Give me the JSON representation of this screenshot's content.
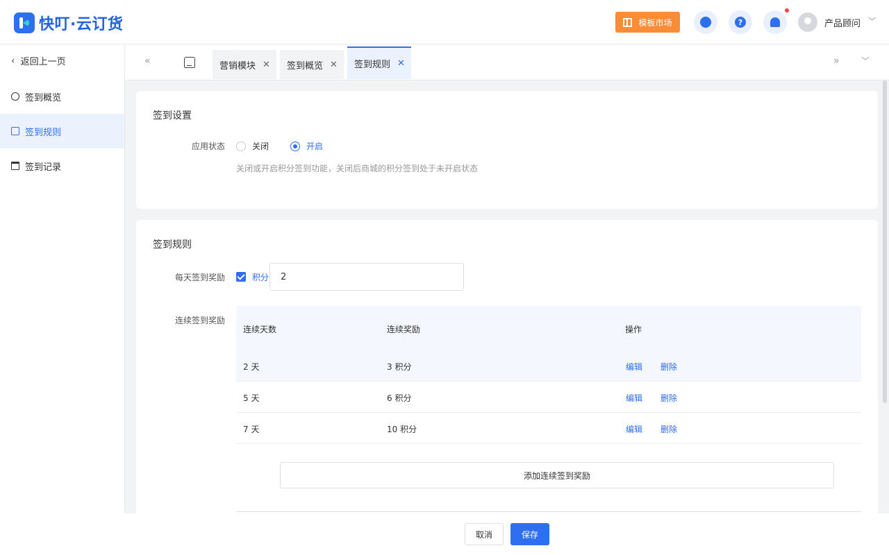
{
  "header": {
    "brand": "快叮·云订货",
    "market_label": "模板市场",
    "help_glyph": "?",
    "user_name": "产品顾问",
    "caret": "﹀"
  },
  "sidebar": {
    "back_arrow": "‹",
    "back_label": "返回上一页",
    "items": [
      {
        "label": "签到概览",
        "icon": "pie-chart-icon"
      },
      {
        "label": "签到规则",
        "icon": "document-icon"
      },
      {
        "label": "签到记录",
        "icon": "calendar-icon"
      }
    ]
  },
  "tabs": {
    "prev": "«",
    "next": "»",
    "dropdown": "﹀",
    "items": [
      {
        "label": "营销模块",
        "close": "✕"
      },
      {
        "label": "签到概览",
        "close": "✕"
      },
      {
        "label": "签到规则",
        "close": "✕"
      }
    ]
  },
  "settings": {
    "title": "签到设置",
    "status_label": "应用状态",
    "option_off": "关闭",
    "option_on": "开启",
    "hint": "关闭或开启积分签到功能，关闭后商城的积分签到处于未开启状态"
  },
  "rules": {
    "title": "签到规则",
    "daily_label": "每天签到奖励",
    "daily_checkbox_label": "积分",
    "daily_value": "2",
    "streak_label": "连续签到奖励",
    "columns": [
      "连续天数",
      "连续奖励",
      "操作"
    ],
    "rows": [
      {
        "days": "2 天",
        "reward": "3 积分",
        "edit": "编辑",
        "delete": "删除"
      },
      {
        "days": "5 天",
        "reward": "6 积分",
        "edit": "编辑",
        "delete": "删除"
      },
      {
        "days": "7 天",
        "reward": "10 积分",
        "edit": "编辑",
        "delete": "删除"
      }
    ],
    "add_label": "添加连续签到奖励"
  },
  "footer": {
    "cancel": "取消",
    "save": "保存"
  },
  "colors": {
    "accent": "#2d6ff0",
    "market": "#fa8c35",
    "badge": "#f5483b"
  }
}
